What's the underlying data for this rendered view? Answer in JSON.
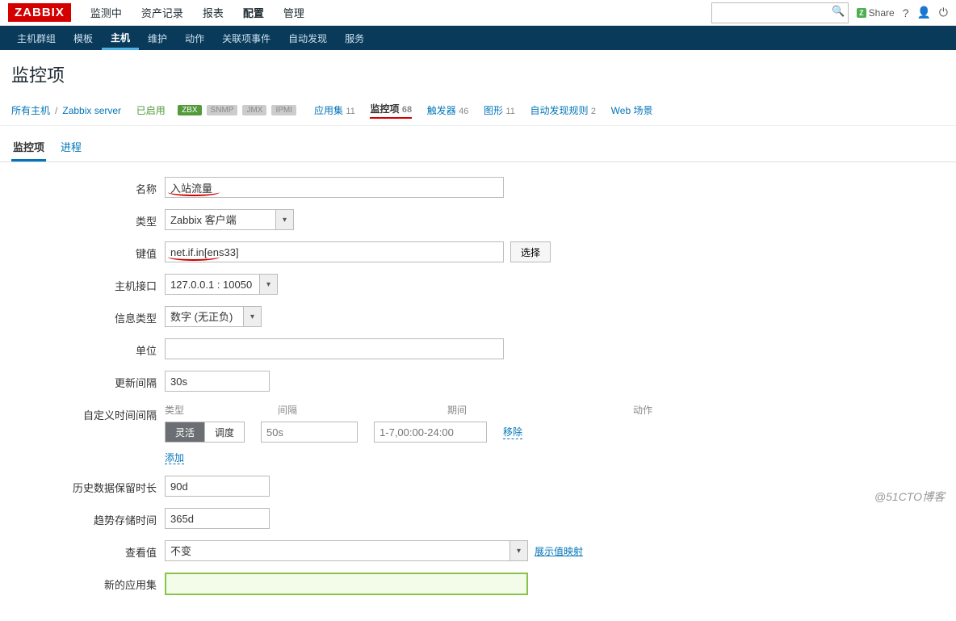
{
  "header": {
    "logo": "ZABBIX",
    "nav": [
      "监测中",
      "资产记录",
      "报表",
      "配置",
      "管理"
    ],
    "nav_active": 3,
    "share": "Share",
    "search_placeholder": ""
  },
  "subnav": {
    "items": [
      "主机群组",
      "模板",
      "主机",
      "维护",
      "动作",
      "关联项事件",
      "自动发现",
      "服务"
    ],
    "active": 2
  },
  "page_title": "监控项",
  "crumb": {
    "all_hosts": "所有主机",
    "host": "Zabbix server",
    "enabled": "已启用",
    "badges": {
      "zbx": "ZBX",
      "snmp": "SNMP",
      "jmx": "JMX",
      "ipmi": "IPMI"
    },
    "links": {
      "apps": {
        "label": "应用集",
        "count": "11"
      },
      "items": {
        "label": "监控项",
        "count": "68"
      },
      "triggers": {
        "label": "触发器",
        "count": "46"
      },
      "graphs": {
        "label": "图形",
        "count": "11"
      },
      "discovery": {
        "label": "自动发现规则",
        "count": "2"
      },
      "web": {
        "label": "Web 场景",
        "count": ""
      }
    }
  },
  "inner_tabs": {
    "item": "监控项",
    "process": "进程"
  },
  "form": {
    "name_label": "名称",
    "name_value": "入站流量",
    "type_label": "类型",
    "type_value": "Zabbix 客户端",
    "key_label": "键值",
    "key_value": "net.if.in[ens33]",
    "key_select_btn": "选择",
    "iface_label": "主机接口",
    "iface_value": "127.0.0.1 : 10050",
    "info_label": "信息类型",
    "info_value": "数字 (无正负)",
    "unit_label": "单位",
    "unit_value": "",
    "update_label": "更新间隔",
    "update_value": "30s",
    "custom_label": "自定义时间间隔",
    "custom_head_type": "类型",
    "custom_head_interval": "间隔",
    "custom_head_period": "期间",
    "custom_head_action": "动作",
    "seg_flex": "灵活",
    "seg_sched": "调度",
    "custom_interval_ph": "50s",
    "custom_period_ph": "1-7,00:00-24:00",
    "remove": "移除",
    "add": "添加",
    "history_label": "历史数据保留时长",
    "history_value": "90d",
    "trend_label": "趋势存储时间",
    "trend_value": "365d",
    "valuemap_label": "查看值",
    "valuemap_value": "不变",
    "valuemap_link": "展示值映射",
    "newapp_label": "新的应用集",
    "newapp_value": ""
  },
  "watermark": "@51CTO博客"
}
